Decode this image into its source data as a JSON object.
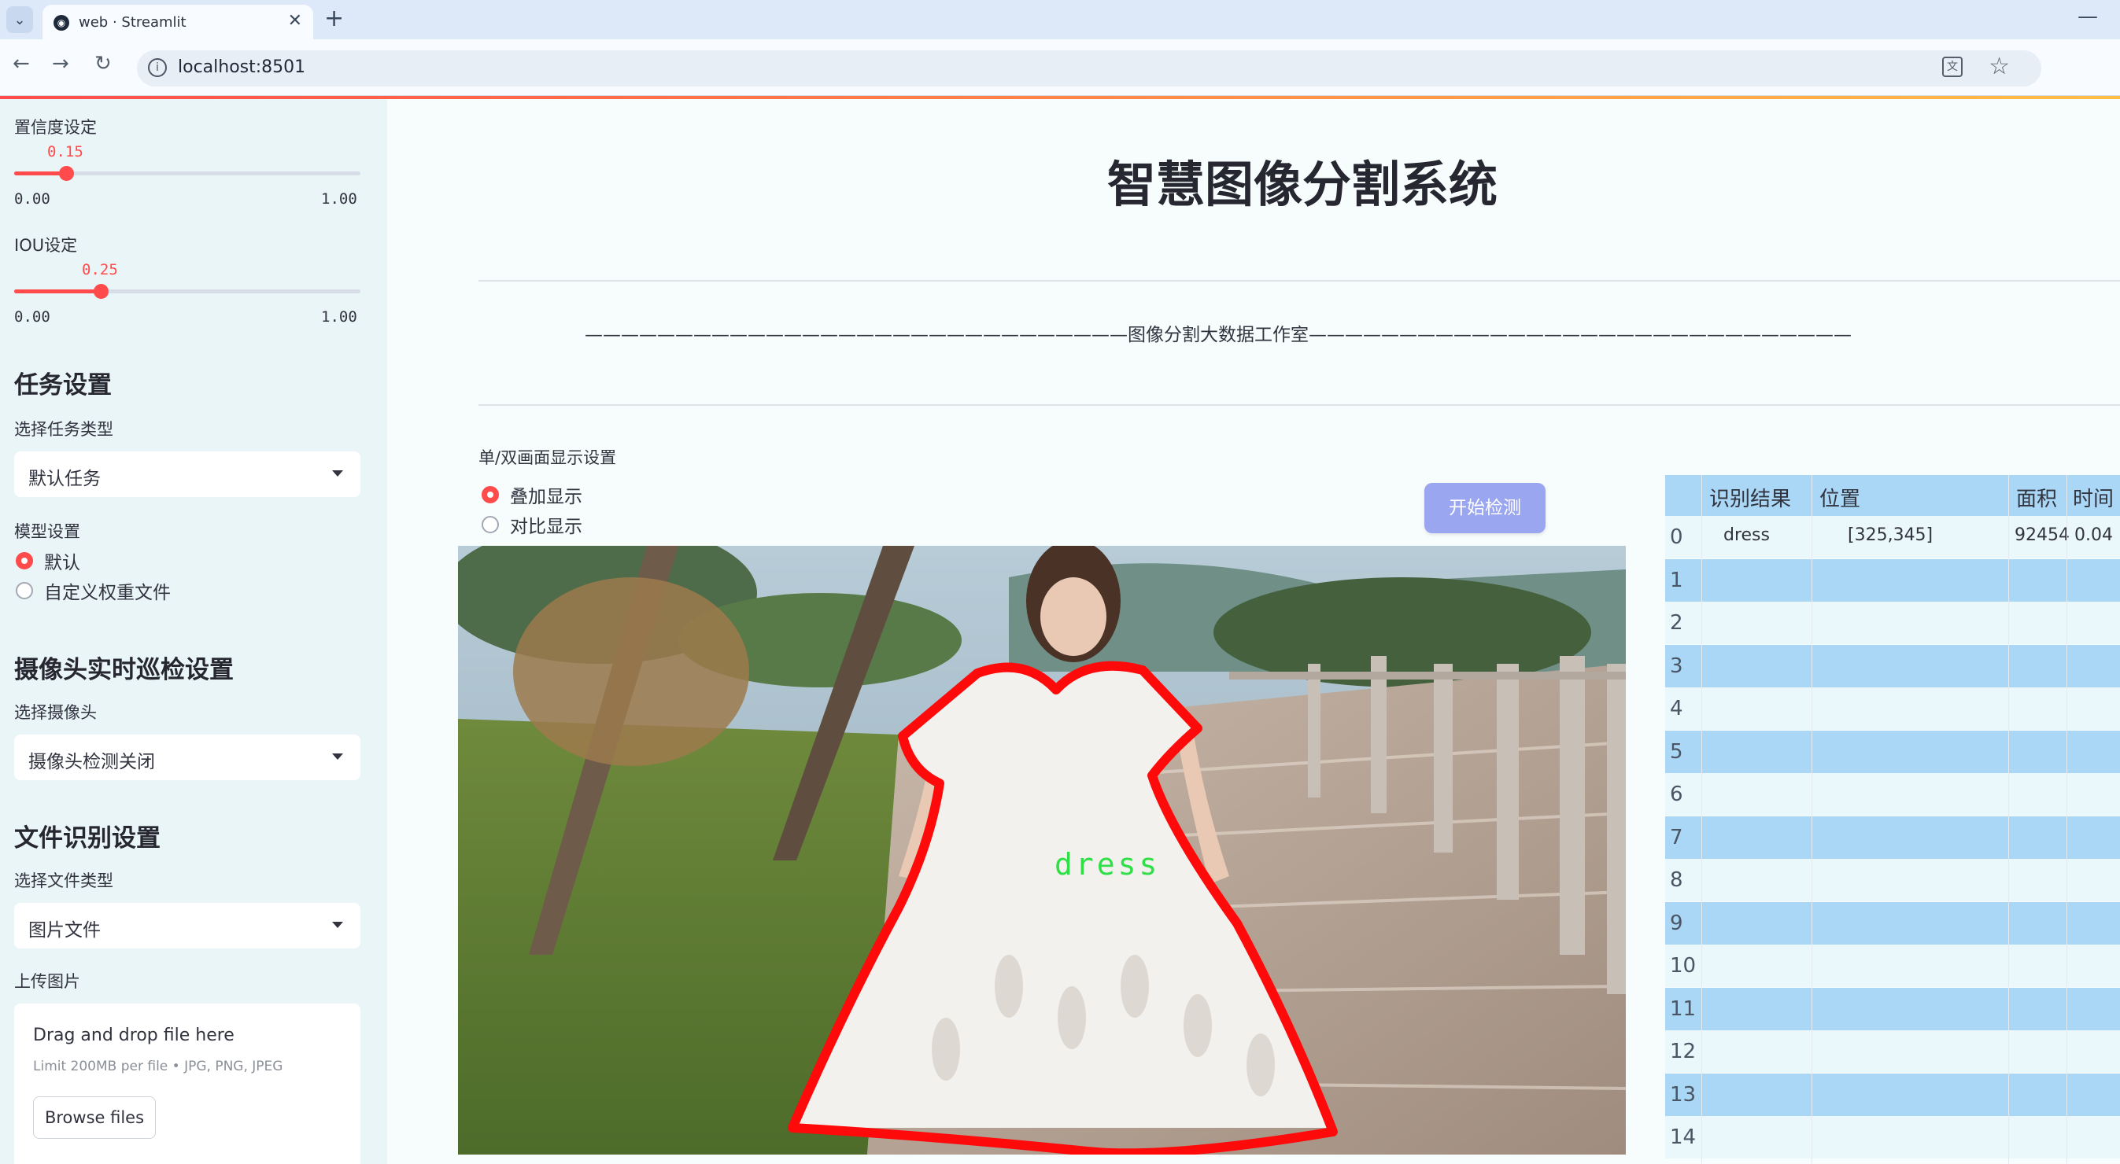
{
  "browser": {
    "tab_title": "web · Streamlit",
    "tab_close": "✕",
    "new_tab": "+",
    "minimize": "—",
    "url": "localhost:8501",
    "back": "←",
    "forward": "→",
    "reload": "↻",
    "star": "☆",
    "info": "i",
    "translate": "文"
  },
  "sidebar": {
    "confidence": {
      "label": "置信度设定",
      "value": "0.15",
      "fraction": 0.15,
      "min": "0.00",
      "max": "1.00"
    },
    "iou": {
      "label": "IOU设定",
      "value": "0.25",
      "fraction": 0.25,
      "min": "0.00",
      "max": "1.00"
    },
    "task_header": "任务设置",
    "task_type_label": "选择任务类型",
    "task_type_value": "默认任务",
    "model_label": "模型设置",
    "model_options": [
      "默认",
      "自定义权重文件"
    ],
    "model_selected": 0,
    "camera_header": "摄像头实时巡检设置",
    "camera_label": "选择摄像头",
    "camera_value": "摄像头检测关闭",
    "file_header": "文件识别设置",
    "file_type_label": "选择文件类型",
    "file_type_value": "图片文件",
    "upload_label": "上传图片",
    "upload_main": "Drag and drop file here",
    "upload_sub": "Limit 200MB per file • JPG, PNG, JPEG",
    "browse_button": "Browse files"
  },
  "main": {
    "title": "智慧图像分割系统",
    "subtitle": "——————————————————————————————图像分割大数据工作室——————————————————————————————",
    "display_label": "单/双画面显示设置",
    "display_options": [
      "叠加显示",
      "对比显示"
    ],
    "display_selected": 0,
    "detect_button": "开始检测",
    "image_label": "dress"
  },
  "table": {
    "headers": [
      "识别结果",
      "位置",
      "面积",
      "时间"
    ],
    "rows": [
      {
        "idx": "0",
        "result": "dress",
        "position": "[325,345]",
        "area": "92454",
        "time": "0.04"
      },
      {
        "idx": "1"
      },
      {
        "idx": "2"
      },
      {
        "idx": "3"
      },
      {
        "idx": "4"
      },
      {
        "idx": "5"
      },
      {
        "idx": "6"
      },
      {
        "idx": "7"
      },
      {
        "idx": "8"
      },
      {
        "idx": "9"
      },
      {
        "idx": "10"
      },
      {
        "idx": "11"
      },
      {
        "idx": "12"
      },
      {
        "idx": "13"
      },
      {
        "idx": "14"
      }
    ]
  },
  "colors": {
    "accent": "#ff4b4b",
    "button": "#9aa6ef",
    "table_stripe": "#a9d7f5",
    "sidebar": "#eaf5f8"
  }
}
